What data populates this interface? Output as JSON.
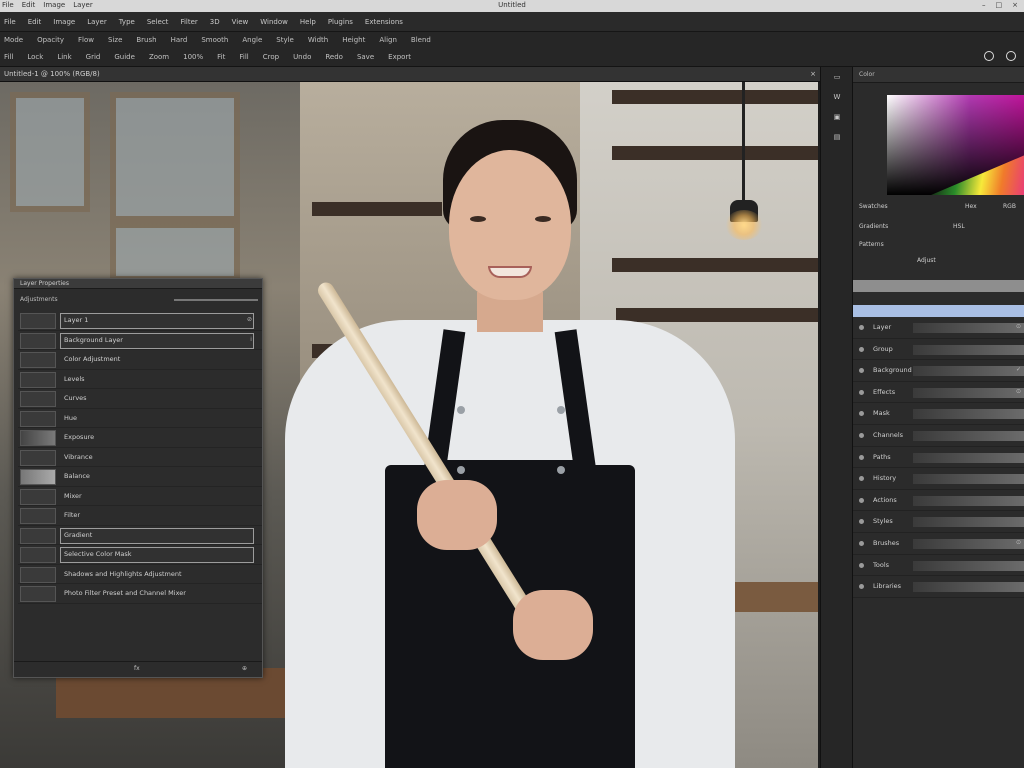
{
  "titlebar": {
    "menu": [
      "File",
      "Edit",
      "Image",
      "Layer"
    ],
    "title": "Untitled",
    "window_buttons": [
      "min",
      "max",
      "close"
    ]
  },
  "menubar": {
    "items": [
      "File",
      "Edit",
      "Image",
      "Layer",
      "Type",
      "Select",
      "Filter",
      "3D",
      "View",
      "Window",
      "Help",
      "Plugins",
      "Extensions"
    ]
  },
  "optionsbar1": {
    "items": [
      "Mode",
      "Opacity",
      "Flow",
      "Size",
      "Brush",
      "Hard",
      "Smooth",
      "Angle",
      "Style",
      "Width",
      "Height",
      "Align",
      "Blend"
    ]
  },
  "optionsbar2": {
    "items": [
      "Fill",
      "Lock",
      "Link",
      "Grid",
      "Guide",
      "Zoom",
      "100%",
      "Fit",
      "Fill",
      "Crop",
      "Undo",
      "Redo",
      "Save",
      "Export"
    ]
  },
  "doctab": {
    "label": "Untitled-1 @ 100% (RGB/8)",
    "close": "×"
  },
  "layers_panel": {
    "title": "Layer Properties",
    "subtitle": "Adjustments",
    "rows": [
      {
        "label": "Layer 1",
        "tick": "⊘",
        "field": true
      },
      {
        "label": "Background Layer",
        "tick": "⁞",
        "field": true
      },
      {
        "label": "Color Adjustment",
        "tick": "",
        "field": false
      },
      {
        "label": "Levels",
        "tick": "",
        "field": false
      },
      {
        "label": "Curves",
        "tick": "",
        "field": false
      },
      {
        "label": "Hue",
        "tick": "",
        "field": false
      },
      {
        "label": "Exposure",
        "tick": "",
        "field": false
      },
      {
        "label": "Vibrance",
        "tick": "",
        "field": false
      },
      {
        "label": "Balance",
        "tick": "",
        "field": false
      },
      {
        "label": "Mixer",
        "tick": "",
        "field": false
      },
      {
        "label": "Filter",
        "tick": "",
        "field": false
      },
      {
        "label": "Gradient",
        "tick": "",
        "field": true
      },
      {
        "label": "Selective Color Mask",
        "tick": "",
        "field": true
      },
      {
        "label": "Shadows and Highlights Adjustment",
        "tick": "",
        "field": false
      },
      {
        "label": "Photo Filter Preset and Channel Mixer",
        "tick": "",
        "field": false
      }
    ],
    "footer": {
      "left": "fx",
      "right": "⊕"
    }
  },
  "toolstrip": {
    "tools": [
      "▭",
      "W",
      "▣",
      "▤"
    ]
  },
  "right_panel": {
    "title": "Color",
    "line1": {
      "left": "Swatches",
      "mid": "Hex",
      "right": "RGB"
    },
    "line2": {
      "left": "Gradients",
      "right": "HSL"
    },
    "line3": {
      "left": "Patterns"
    },
    "line4": {
      "mid": "Adjust"
    },
    "items": [
      {
        "name": "Layer",
        "tick": "⊙"
      },
      {
        "name": "Group",
        "tick": ""
      },
      {
        "name": "Background",
        "tick": "✓"
      },
      {
        "name": "Effects",
        "tick": "⊙"
      },
      {
        "name": "Mask",
        "tick": ""
      },
      {
        "name": "Channels",
        "tick": ""
      },
      {
        "name": "Paths",
        "tick": ""
      },
      {
        "name": "History",
        "tick": ""
      },
      {
        "name": "Actions",
        "tick": ""
      },
      {
        "name": "Styles",
        "tick": ""
      },
      {
        "name": "Brushes",
        "tick": "⊙"
      },
      {
        "name": "Tools",
        "tick": ""
      },
      {
        "name": "Libraries",
        "tick": ""
      }
    ]
  },
  "colors": {
    "panel_bg": "#2b2b2b",
    "highlight": "#a9bfe4",
    "canvas_bg": "#4a4a44"
  }
}
